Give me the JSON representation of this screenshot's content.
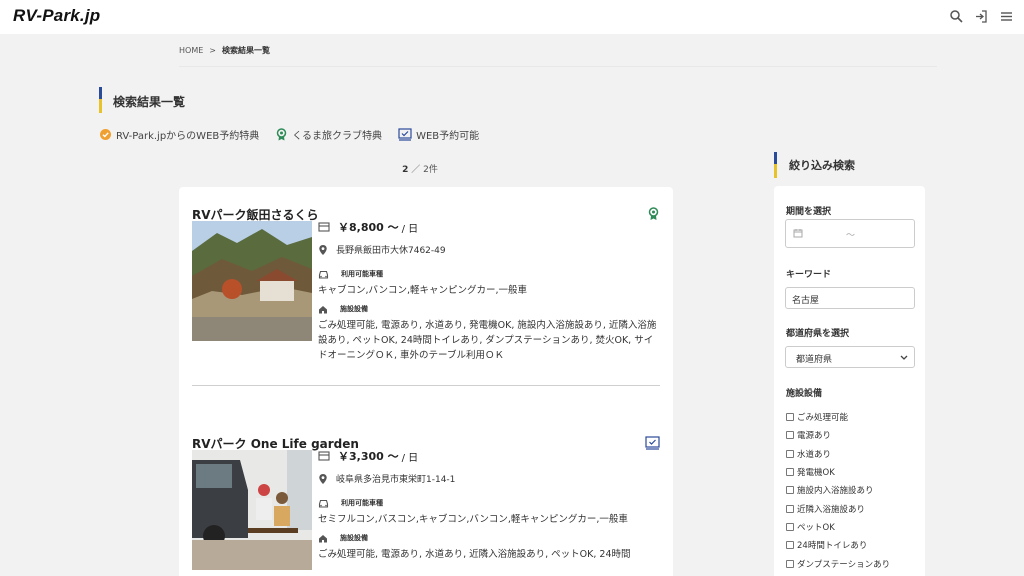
{
  "header": {
    "logo": "RV-Park.jp",
    "icons": [
      "search-icon",
      "login-icon",
      "menu-icon"
    ]
  },
  "breadcrumb": {
    "home": "HOME",
    "sep": ">",
    "current": "検索結果一覧"
  },
  "page_title": "検索結果一覧",
  "legend": [
    {
      "icon": "web-badge-icon",
      "label": "RV-Park.jpからのWEB予約特典"
    },
    {
      "icon": "kuruma-club-icon",
      "label": "くるま旅クラブ特典"
    },
    {
      "icon": "web-booking-icon",
      "label": "WEB予約可能"
    }
  ],
  "result_count": {
    "shown": "2",
    "total": "／ 2件"
  },
  "results": [
    {
      "name": "RVパーク飯田さるくら",
      "badge": "kuruma-club-icon",
      "price": "￥8,800 〜",
      "price_unit": "/ 日",
      "address": "長野県飯田市大休7462-49",
      "vehicle_label": "利用可能車種",
      "vehicles": "キャブコン,バンコン,軽キャンピングカー,一般車",
      "facility_label": "施設設備",
      "facilities": "ごみ処理可能, 電源あり, 水道あり, 発電機OK, 施設内入浴施設あり, 近隣入浴施設あり, ペットOK, 24時間トイレあり, ダンプステーションあり, 焚火OK, サイドオーニングＯＫ, 車外のテーブル利用ＯＫ"
    },
    {
      "name": "RVパーク One Life garden",
      "badge": "web-booking-icon",
      "price": "￥3,300 〜",
      "price_unit": "/ 日",
      "address": "岐阜県多治見市東栄町1-14-1",
      "vehicle_label": "利用可能車種",
      "vehicles": "セミフルコン,バスコン,キャブコン,バンコン,軽キャンピングカー,一般車",
      "facility_label": "施設設備",
      "facilities": "ごみ処理可能, 電源あり, 水道あり, 近隣入浴施設あり, ペットOK, 24時間"
    }
  ],
  "sidebar": {
    "title": "絞り込み検索",
    "period_label": "期間を選択",
    "period_sep": "〜",
    "keyword_label": "キーワード",
    "keyword_value": "名古屋",
    "pref_label": "都道府県を選択",
    "pref_value": "都道府県",
    "facility_label": "施設設備",
    "facilities": [
      "ごみ処理可能",
      "電源あり",
      "水道あり",
      "発電機OK",
      "施設内入浴施設あり",
      "近隣入浴施設あり",
      "ペットOK",
      "24時間トイレあり",
      "ダンプステーションあり"
    ]
  },
  "colors": {
    "accent_blue": "#2a4a9a",
    "accent_yellow": "#e8c22a",
    "badge_green": "#2e8b57",
    "badge_orange": "#f0a030"
  }
}
